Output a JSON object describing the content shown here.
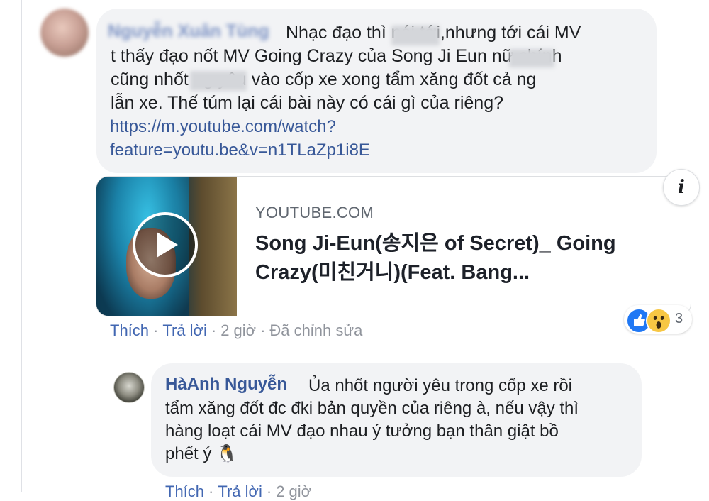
{
  "comment": {
    "author": "Nguyễn Xuân Tùng",
    "lines": [
      "Nhạc đạo thì      nói tới,nhưng tới cái MV",
      "t thấy đạo nốt MV Going Crazy của Song Ji Eun       nữ chính",
      "cũng nhốt          ng yêu vào cốp xe xong tẩm xăng đốt cả ng",
      "lẫn xe. Thế túm lại cái bài này có cái gì của riêng?"
    ],
    "link_lines": [
      "https://m.youtube.com/watch?",
      "feature=youtu.be&v=n1TLaZp1i8E"
    ],
    "actions": {
      "like": "Thích",
      "reply": "Trả lời",
      "time": "2 giờ",
      "edited": "Đã chỉnh sửa"
    },
    "reaction_count": "3"
  },
  "preview": {
    "domain": "YOUTUBE.COM",
    "title": "Song Ji-Eun(송지은 of Secret)_ Going Crazy(미친거니)(Feat. Bang..."
  },
  "reply": {
    "author": "HàAnh Nguyễn",
    "lines": [
      "Ủa nhốt người yêu trong cốp xe rồi",
      "tẩm xăng đốt đc đki bản quyền của riêng à, nếu vậy thì",
      "hàng loạt cái MV đạo nhau ý tưởng bạn thân giật bồ",
      "phết ý 🐧"
    ],
    "actions": {
      "like": "Thích",
      "reply": "Trả lời",
      "time": "2 giờ"
    }
  },
  "icons": [
    "info-icon",
    "play-icon",
    "like-reaction-icon",
    "wow-reaction-icon",
    "penguin-emoji-icon"
  ],
  "colors": {
    "bubble": "#f2f3f5",
    "link": "#385898",
    "meta": "#90949c",
    "like": "#2078f4",
    "wow": "#f7c744"
  }
}
